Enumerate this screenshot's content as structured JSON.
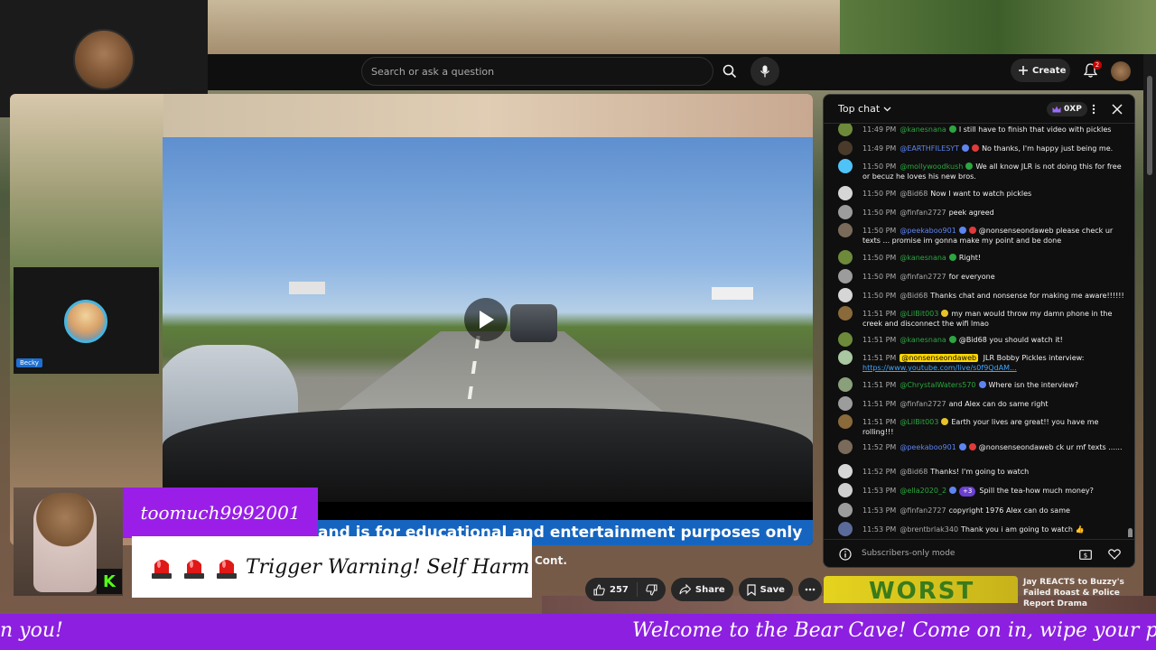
{
  "topbar": {
    "search_placeholder": "Search or ask a question",
    "create_label": "Create",
    "notifications_count": "2"
  },
  "overlay": {
    "cam_name": "Becky",
    "streamer_name": "toomuch9992001",
    "warning_text": "Trigger Warning! Self Harm",
    "ticker_left": "n you!",
    "ticker_main": "Welcome to the Bear Cave! Come on in, wipe your paws",
    "kick_letter": "K"
  },
  "video": {
    "banner_text": "and is for educational and entertainment purposes only",
    "title_suffix": "Cont."
  },
  "actions": {
    "like_count": "257",
    "share_label": "Share",
    "save_label": "Save"
  },
  "chat": {
    "mode_label": "Top chat",
    "xp_label": "0XP",
    "footer_label": "Subscribers-only mode",
    "messages": [
      {
        "time": "11:49 PM",
        "author": "@kanesnana",
        "text": "I still have to finish that video with pickles"
      },
      {
        "time": "11:49 PM",
        "author": "@EARTHFILESYT",
        "text": "No thanks, I'm happy just being me."
      },
      {
        "time": "11:50 PM",
        "author": "@mollywoodkush",
        "text": "We all know JLR is not doing this for free or becuz he loves his new bros."
      },
      {
        "time": "11:50 PM",
        "author": "@Bid68",
        "text": "Now I want to watch pickles"
      },
      {
        "time": "11:50 PM",
        "author": "@finfan2727",
        "text": "peek agreed"
      },
      {
        "time": "11:50 PM",
        "author": "@peekaboo901",
        "text": "@nonsenseondaweb please check ur texts ... promise im gonna make my point and be done"
      },
      {
        "time": "11:50 PM",
        "author": "@kanesnana",
        "text": "Right!"
      },
      {
        "time": "11:50 PM",
        "author": "@finfan2727",
        "text": "for everyone"
      },
      {
        "time": "11:50 PM",
        "author": "@Bid68",
        "text": "Thanks chat and nonsense for making me aware!!!!!!"
      },
      {
        "time": "11:51 PM",
        "author": "@LilBit003",
        "text": "my man would throw my damn phone in the creek and disconnect the wifi lmao"
      },
      {
        "time": "11:51 PM",
        "author": "@kanesnana",
        "text": "@Bid68 you should watch it!"
      },
      {
        "time": "11:51 PM",
        "author": "@nonsenseondaweb",
        "text": "JLR Bobby Pickles interview: ",
        "link": "https://www.youtube.com/live/s0f9QdAM..."
      },
      {
        "time": "11:51 PM",
        "author": "@ChrystalWaters570",
        "text": "Where isn the interview?"
      },
      {
        "time": "11:51 PM",
        "author": "@finfan2727",
        "text": "and Alex can do same right"
      },
      {
        "time": "11:51 PM",
        "author": "@LilBit003",
        "text": "Earth your lives are great!! you have me rolling!!!"
      },
      {
        "time": "11:52 PM",
        "author": "@peekaboo901",
        "text": "@nonsenseondaweb ck ur mf texts ......"
      },
      {
        "time": "11:52 PM",
        "author": "@Bid68",
        "text": "Thanks! I'm going to watch"
      },
      {
        "time": "11:53 PM",
        "author": "@ella2020_2",
        "badge": "+3",
        "text": "Spill the tea-how much money?"
      },
      {
        "time": "11:53 PM",
        "author": "@finfan2727",
        "text": "copyright 1976 Alex can do same"
      },
      {
        "time": "11:53 PM",
        "author": "@brentbrlak340",
        "text": "Thank you i am going to watch 👍"
      }
    ]
  },
  "recommended": {
    "thumb_text": "WORST",
    "title": "Jay REACTS to Buzzy's Failed Roast & Police Report Drama"
  }
}
